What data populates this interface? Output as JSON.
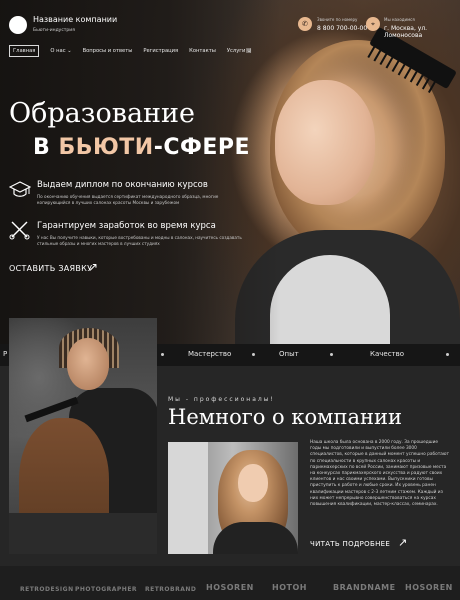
{
  "header": {
    "company_name": "Название компании",
    "company_sub": "Бьюти-индустрия",
    "phone_label": "Звоните по номеру",
    "phone": "8 800 700-00-00",
    "address_label": "Мы находимся",
    "address": "г. Москва, ул. Ломоносова"
  },
  "nav": {
    "items": [
      {
        "label": "Главная",
        "active": true
      },
      {
        "label": "О нас ⌄"
      },
      {
        "label": "Вопросы и ответы"
      },
      {
        "label": "Регистрация"
      },
      {
        "label": "Контакты"
      },
      {
        "label": "Услуги ⌄"
      }
    ]
  },
  "hero": {
    "title_line1": "Образование",
    "title_line2_prefix": "В ",
    "title_line2_accent": "БЬЮТИ",
    "title_line2_suffix": "-СФЕРЕ",
    "accent_color": "#f2c7a6",
    "features": [
      {
        "icon": "graduation-cap-icon",
        "title": "Выдаем диплом по окончанию курсов",
        "text": "По окончанию обучения выдается сертификат международного образца, многие копирующийся в лучших салонах красоты Москвы и зарубежом"
      },
      {
        "icon": "scissors-comb-icon",
        "title": "Гарантируем заработок во время курса",
        "text": "У нас Вы получите навыки, которые востребованы и модны в салонах, научитесь создавать стильные образы и многих мастеров в лучших студиях"
      }
    ],
    "cta": "ОСТАВИТЬ ЗАЯВКУ"
  },
  "ticker": {
    "items": [
      "Р",
      "Мастерство",
      "Опыт",
      "Качество"
    ]
  },
  "about": {
    "tag": "Мы - профессионалы!",
    "title": "Немного о компании",
    "text": "Наша школа была основана в 2000 году. За прошедшие годы мы подготовили и выпустили более 3000 специалистов, которые в данный момент успешно работают по специальности в крупных салонах красоты и парикмахерских по всей России, занимают призовые места на конкурсах парикмахерского искусства и радуют своих клиентов и нас своими успехами. Выпускники готовы приступить к работе и любые сроки. Их уровень ранен квалификации мастеров с 2-3 летним стажем. Каждый из них может непрерывно совершенствоваться на курсах повышения квалификации, мастер-классах, семинарах.",
    "more": "ЧИТАТЬ ПОДРОБНЕЕ"
  },
  "brands": [
    "RETRODESIGN",
    "PHOTOGRAPHER",
    "RETROBRAND",
    "HOSOREN",
    "HOTOH",
    "BRANDNAME",
    "HOSOREN"
  ]
}
